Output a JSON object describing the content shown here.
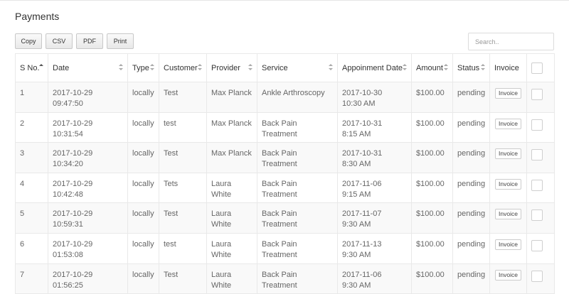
{
  "page": {
    "title": "Payments"
  },
  "toolbar": {
    "copy": "Copy",
    "csv": "CSV",
    "pdf": "PDF",
    "print": "Print"
  },
  "search": {
    "placeholder": "Search.."
  },
  "table": {
    "headers": {
      "sno": "S No.",
      "date": "Date",
      "type": "Type",
      "customer": "Customer",
      "provider": "Provider",
      "service": "Service",
      "appointment": "Appoinment Date",
      "amount": "Amount",
      "status": "Status",
      "invoice": "Invoice"
    },
    "rows": [
      {
        "sno": "1",
        "date": "2017-10-29 09:47:50",
        "type": "locally",
        "customer": "Test",
        "provider": "Max Planck",
        "service": "Ankle Arthroscopy",
        "appt_date": "2017-10-30",
        "appt_time": "10:30 AM",
        "amount": "$100.00",
        "status": "pending",
        "invoice": "Invoice"
      },
      {
        "sno": "2",
        "date": "2017-10-29 10:31:54",
        "type": "locally",
        "customer": "test",
        "provider": "Max Planck",
        "service": "Back Pain Treatment",
        "appt_date": "2017-10-31",
        "appt_time": "8:15 AM",
        "amount": "$100.00",
        "status": "pending",
        "invoice": "Invoice"
      },
      {
        "sno": "3",
        "date": "2017-10-29 10:34:20",
        "type": "locally",
        "customer": "Test",
        "provider": "Max Planck",
        "service": "Back Pain Treatment",
        "appt_date": "2017-10-31",
        "appt_time": "8:30 AM",
        "amount": "$100.00",
        "status": "pending",
        "invoice": "Invoice"
      },
      {
        "sno": "4",
        "date": "2017-10-29 10:42:48",
        "type": "locally",
        "customer": "Tets",
        "provider": "Laura White",
        "service": "Back Pain Treatment",
        "appt_date": "2017-11-06",
        "appt_time": "9:15 AM",
        "amount": "$100.00",
        "status": "pending",
        "invoice": "Invoice"
      },
      {
        "sno": "5",
        "date": "2017-10-29 10:59:31",
        "type": "locally",
        "customer": "Test",
        "provider": "Laura White",
        "service": "Back Pain Treatment",
        "appt_date": "2017-11-07",
        "appt_time": "9:30 AM",
        "amount": "$100.00",
        "status": "pending",
        "invoice": "Invoice"
      },
      {
        "sno": "6",
        "date": "2017-10-29 01:53:08",
        "type": "locally",
        "customer": "test",
        "provider": "Laura White",
        "service": "Back Pain Treatment",
        "appt_date": "2017-11-13",
        "appt_time": "9:30 AM",
        "amount": "$100.00",
        "status": "pending",
        "invoice": "Invoice"
      },
      {
        "sno": "7",
        "date": "2017-10-29 01:56:25",
        "type": "locally",
        "customer": "Test",
        "provider": "Laura White",
        "service": "Back Pain Treatment",
        "appt_date": "2017-11-06",
        "appt_time": "9:30 AM",
        "amount": "$100.00",
        "status": "pending",
        "invoice": "Invoice"
      }
    ]
  }
}
